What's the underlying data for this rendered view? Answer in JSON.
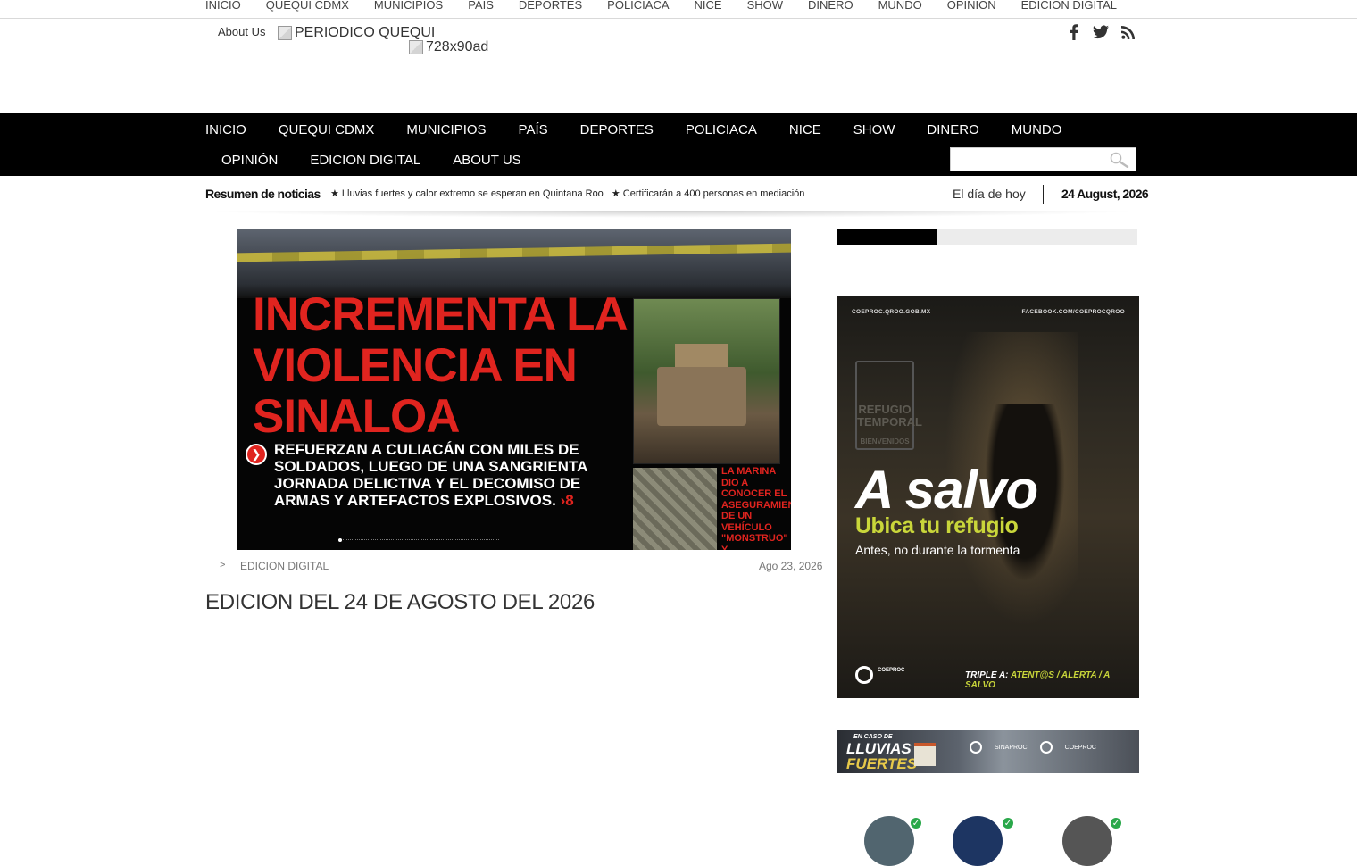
{
  "top_nav": {
    "items": [
      "INICIO",
      "QUEQUI CDMX",
      "MUNICIPIOS",
      "PAIS",
      "DEPORTES",
      "POLICIACA",
      "NICE",
      "SHOW",
      "DINERO",
      "MUNDO",
      "OPINION",
      "EDICION DIGITAL"
    ]
  },
  "header": {
    "about_label": "About Us",
    "logo_alt": "PERIODICO QUEQUI",
    "ad_alt": "728x90ad",
    "social_icons": [
      "facebook-icon",
      "twitter-icon",
      "rss-icon"
    ]
  },
  "main_nav": {
    "row1": [
      "INICIO",
      "QUEQUI CDMX",
      "MUNICIPIOS",
      "PAÍS",
      "DEPORTES",
      "POLICIACA",
      "NICE",
      "SHOW",
      "DINERO",
      "MUNDO"
    ],
    "row2": [
      "OPINIÓN",
      "EDICION DIGITAL",
      "ABOUT US"
    ],
    "search_placeholder": ""
  },
  "ticker": {
    "label": "Resumen de noticias",
    "items": [
      "★ Lluvias fuertes y calor extremo se esperan en Quintana Roo",
      "★ Certificarán a 400 personas en mediación"
    ],
    "today_label": "El día de hoy",
    "today_date": "24 August, 2026"
  },
  "featured": {
    "headline": "INCREMENTA LA VIOLENCIA EN SINALOA",
    "subhead": "REFUERZAN A CULIACÁN CON MILES DE SOLDADOS, LUEGO DE UNA SANGRIENTA JORNADA DELICTIVA Y EL DECOMISO DE ARMAS Y ARTEFACTOS EXPLOSIVOS.",
    "page_ref": "›8",
    "side_note": "LA MARINA DIO A CONOCER EL ASEGURAMIENTO DE UN VEHÍCULO \"MONSTRUO\" Y EXPLOSIVOS",
    "breadcrumb_sep": ">",
    "category": "EDICION DIGITAL",
    "date": "Ago 23, 2026",
    "title": "EDICION DEL 24 DE AGOSTO DEL 2026"
  },
  "sidebar": {
    "progress": 0.33,
    "ad": {
      "site": "COEPROC.QROO.GOB.MX",
      "social": "FACEBOOK.COM/COEPROCQROO",
      "sign": "REFUGIO TEMPORAL",
      "sign_sub": "BIENVENIDOS",
      "headline": "A salvo",
      "subhead": "Ubica tu refugio",
      "tagline": "Antes, no durante la tormenta",
      "logo_text": "COEPROC",
      "footer_prefix": "TRIPLE A:",
      "footer_highlight": "ATENT@S / ALERTA / A SALVO"
    },
    "banner": {
      "small": "EN CASO DE",
      "line1": "LLUVIAS",
      "line2": "FUERTES",
      "logo1": "SINAPROC",
      "logo2": "COEPROC"
    }
  },
  "colors": {
    "nav_bg": "#000000",
    "headline_red": "#e0241f",
    "ad_accent": "#c9d63a",
    "verified": "#2aa84a"
  }
}
